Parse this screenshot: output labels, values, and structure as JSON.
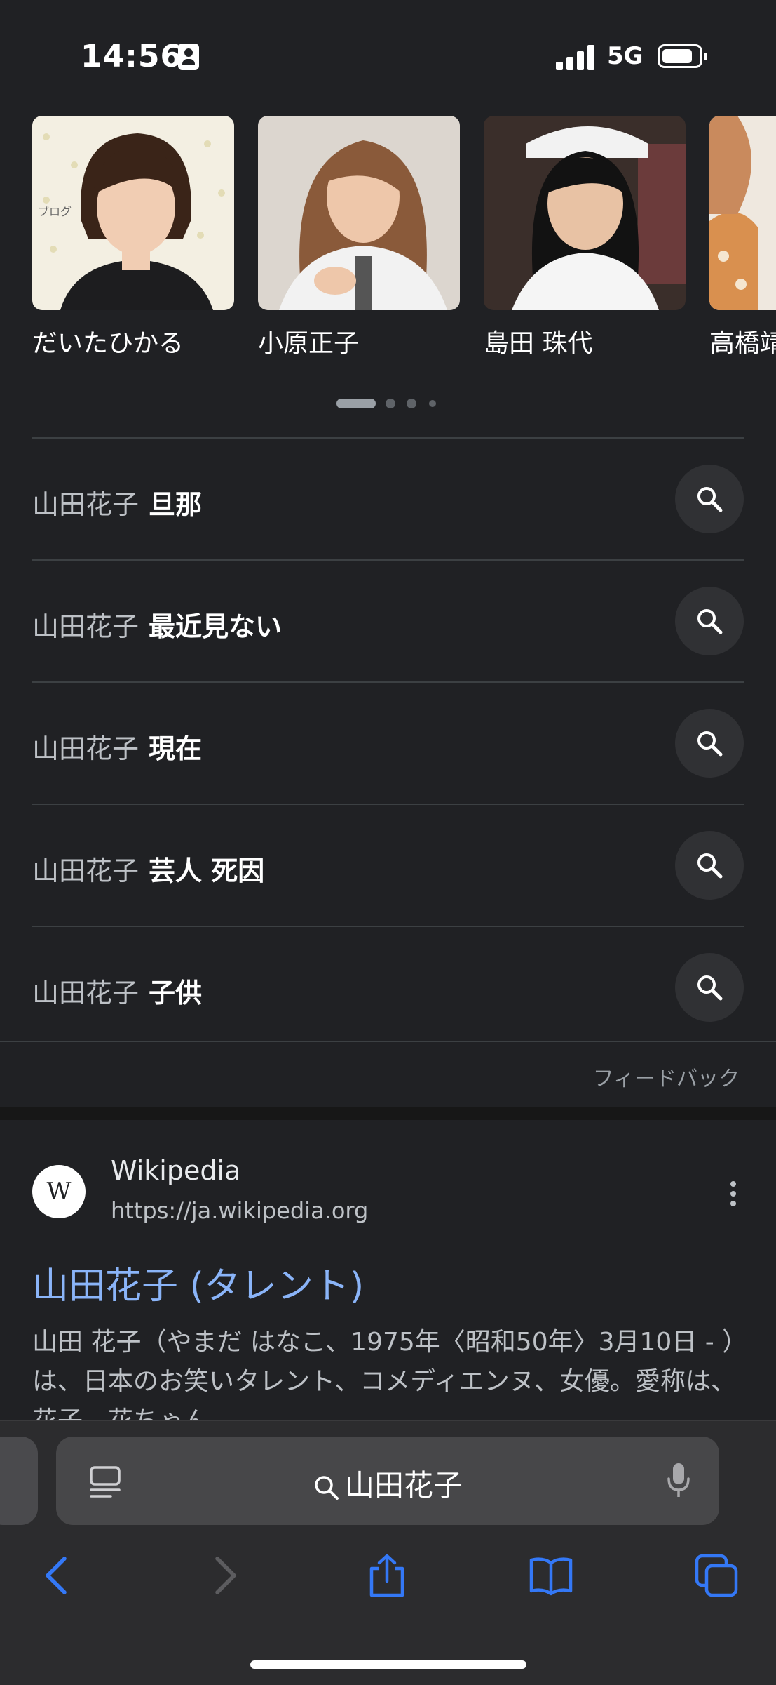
{
  "status_bar": {
    "time": "14:56",
    "network": "5G"
  },
  "people": [
    {
      "name": "だいたひかる",
      "photo_watermark": "ブログ"
    },
    {
      "name": "小原正子",
      "photo_watermark": ""
    },
    {
      "name": "島田 珠代",
      "photo_watermark": ""
    },
    {
      "name": "高橋靖",
      "photo_watermark": ""
    }
  ],
  "related_searches": [
    {
      "base": "山田花子",
      "suffix": "旦那"
    },
    {
      "base": "山田花子",
      "suffix": "最近見ない"
    },
    {
      "base": "山田花子",
      "suffix": "現在"
    },
    {
      "base": "山田花子",
      "suffix": "芸人 死因"
    },
    {
      "base": "山田花子",
      "suffix": "子供"
    }
  ],
  "feedback_label": "フィードバック",
  "result": {
    "site_logo": "W",
    "site_name": "Wikipedia",
    "url": "https://ja.wikipedia.org",
    "title": "山田花子 (タレント)",
    "snippet": "山田 花子（やまだ はなこ、1975年〈昭和50年〉3月10日 - ）は、日本のお笑いタレント、コメディエンヌ、女優。愛称は、花子、花ちゃん。"
  },
  "address_bar": {
    "query": "山田花子"
  },
  "icons": {
    "reader": "reader-icon",
    "search": "search-icon",
    "mic": "microphone-icon",
    "back": "chevron-left-icon",
    "forward": "chevron-right-icon",
    "share": "share-icon",
    "bookmarks": "book-icon",
    "tabs": "tabs-icon"
  },
  "colors": {
    "link": "#8ab4f8",
    "accent": "#3478f6",
    "background": "#202124"
  }
}
